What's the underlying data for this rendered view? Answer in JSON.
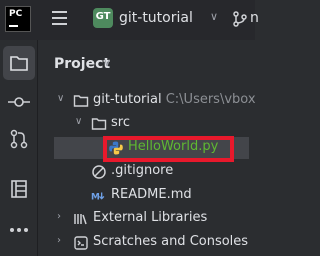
{
  "app": {
    "logo_text": "PC"
  },
  "toolbar": {
    "project_badge": "GT",
    "project_name": "git-tutorial",
    "branch_label": "n"
  },
  "panel": {
    "title": "Project",
    "tree": [
      {
        "label": "git-tutorial",
        "hint": "C:\\Users\\vbox",
        "icon": "folder-icon",
        "expanded": true
      },
      {
        "label": "src",
        "icon": "folder-icon",
        "expanded": true
      },
      {
        "label": "HelloWorld.py",
        "icon": "python-file-icon",
        "selected": true,
        "color": "#5fb832"
      },
      {
        "label": ".gitignore",
        "icon": "ignore-file-icon"
      },
      {
        "label": "README.md",
        "icon": "markdown-file-icon"
      },
      {
        "label": "External Libraries",
        "icon": "libraries-icon",
        "expanded": false
      },
      {
        "label": "Scratches and Consoles",
        "icon": "scratches-icon",
        "expanded": false
      }
    ]
  },
  "sidebar": {
    "tools": [
      {
        "name": "project",
        "icon": "folder-icon",
        "active": true
      },
      {
        "name": "commit",
        "icon": "commit-icon"
      },
      {
        "name": "pull-requests",
        "icon": "pull-request-icon"
      },
      {
        "name": "structure",
        "icon": "structure-icon"
      },
      {
        "name": "more",
        "icon": "more-icon"
      }
    ]
  },
  "colors": {
    "highlight": "#e8192c",
    "badge": "#4e8a5e",
    "python_file": "#5fb832"
  }
}
